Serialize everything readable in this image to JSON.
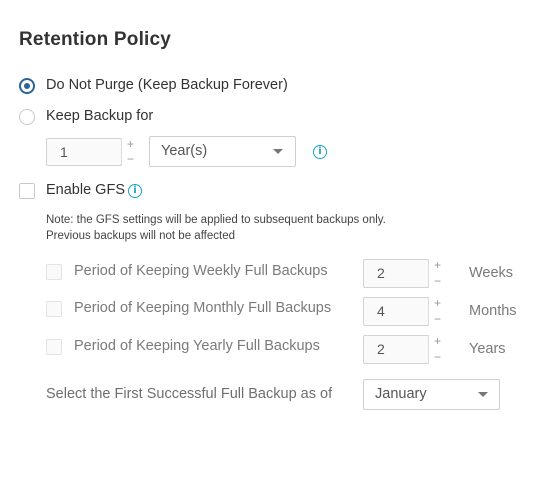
{
  "title": "Retention Policy",
  "options": {
    "do_not_purge": {
      "label": "Do Not Purge (Keep Backup Forever)",
      "selected": true
    },
    "keep_backup_for": {
      "label": "Keep Backup for",
      "selected": false,
      "amount": "1",
      "unit": "Year(s)"
    }
  },
  "gfs": {
    "enable_label": "Enable GFS",
    "enabled": false,
    "note_line1": "Note: the GFS settings will be applied to subsequent backups only.",
    "note_line2": "Previous backups will not be affected",
    "rows": [
      {
        "label": "Period of Keeping Weekly Full Backups",
        "value": "2",
        "unit": "Weeks"
      },
      {
        "label": "Period of Keeping Monthly Full Backups",
        "value": "4",
        "unit": "Months"
      },
      {
        "label": "Period of Keeping Yearly Full Backups",
        "value": "2",
        "unit": "Years"
      }
    ],
    "first_backup_label": "Select the First Successful Full Backup as of",
    "first_backup_value": "January"
  },
  "stepper": {
    "plus": "+",
    "minus": "−"
  },
  "icons": {
    "info": "i"
  },
  "colors": {
    "accent": "#2a6496",
    "info": "#1aa3c2"
  }
}
